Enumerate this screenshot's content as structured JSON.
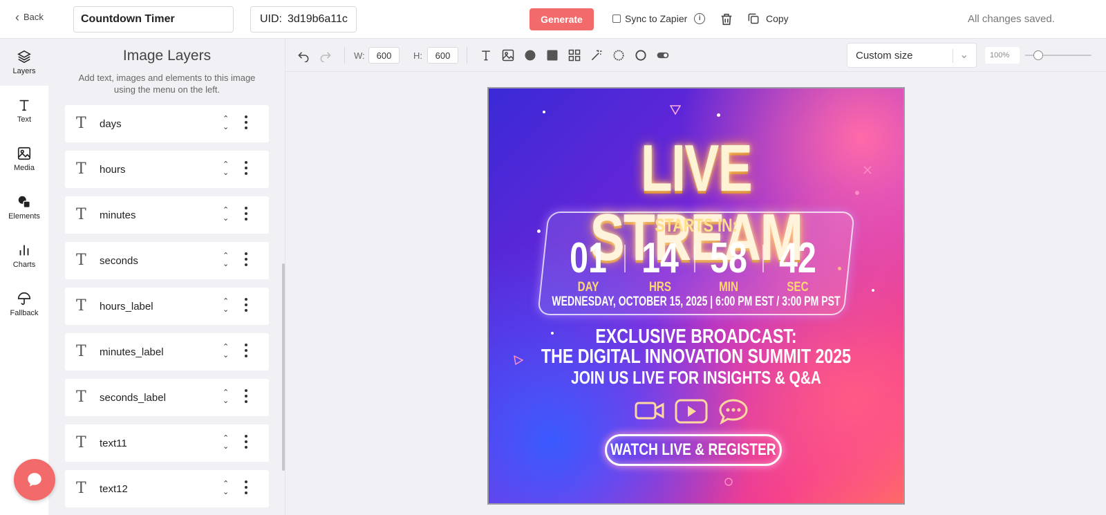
{
  "topbar": {
    "back_label": "Back",
    "template_name": "Countdown Timer",
    "uid_label": "UID:",
    "uid_value": "3d19b6a11c",
    "generate_label": "Generate",
    "sync_label": "Sync to Zapier",
    "sync_checked": false,
    "copy_label": "Copy",
    "save_status": "All changes saved."
  },
  "rail": {
    "items": [
      {
        "label": "Layers",
        "icon": "layers-icon",
        "active": true
      },
      {
        "label": "Text",
        "icon": "text-icon"
      },
      {
        "label": "Media",
        "icon": "image-icon"
      },
      {
        "label": "Elements",
        "icon": "shapes-icon"
      },
      {
        "label": "Charts",
        "icon": "bar-chart-icon"
      },
      {
        "label": "Fallback",
        "icon": "umbrella-icon"
      }
    ]
  },
  "layers_panel": {
    "title": "Image Layers",
    "subtitle": "Add text, images and elements to this image using the menu on the left.",
    "layers": [
      "days",
      "hours",
      "minutes",
      "seconds",
      "hours_label",
      "minutes_label",
      "seconds_label",
      "text11",
      "text12"
    ]
  },
  "toolbar": {
    "width_label": "W:",
    "width_value": "600",
    "height_label": "H:",
    "height_value": "600",
    "size_preset": "Custom size",
    "zoom": "100%",
    "zoom_fraction": 0.2
  },
  "poster": {
    "title": "LIVE STREAM",
    "starts_in": "STARTS IN:",
    "units": [
      {
        "value": "01",
        "label": "DAY"
      },
      {
        "value": "14",
        "label": "HRS"
      },
      {
        "value": "58",
        "label": "MIN"
      },
      {
        "value": "42",
        "label": "SEC"
      }
    ],
    "date_line": "WEDNESDAY, OCTOBER 15, 2025 | 6:00 PM EST / 3:00 PM PST",
    "line1": "EXCLUSIVE BROADCAST:",
    "line2": "THE DIGITAL INNOVATION SUMMIT 2025",
    "line3": "JOIN US LIVE FOR INSIGHTS & Q&A",
    "cta": "WATCH LIVE & REGISTER"
  },
  "colors": {
    "accent": "#f26a6a",
    "title_glow": "#ffd48a",
    "label_gold": "#ffd870"
  }
}
